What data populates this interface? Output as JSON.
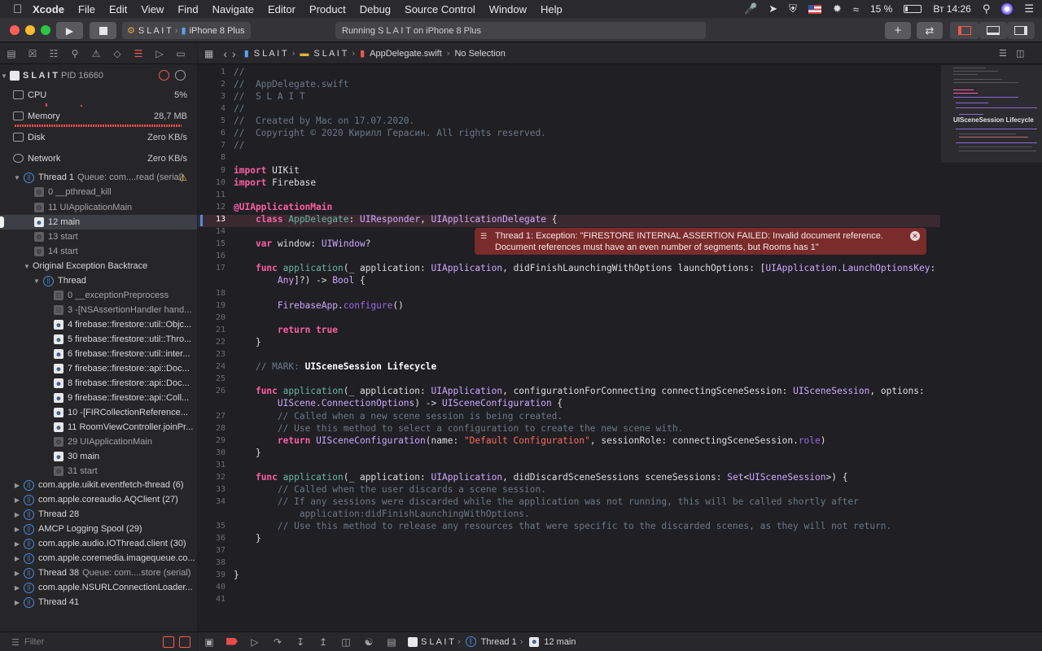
{
  "menubar": {
    "apple": "",
    "app": "Xcode",
    "items": [
      "File",
      "Edit",
      "View",
      "Find",
      "Navigate",
      "Editor",
      "Product",
      "Debug",
      "Source Control",
      "Window",
      "Help"
    ],
    "battery": "15 %",
    "clock": "Вт 14:26"
  },
  "toolbar": {
    "scheme_project": "S L A I T",
    "scheme_device": "iPhone 8 Plus",
    "activity": "Running S L A I T on iPhone 8 Plus"
  },
  "process": {
    "name": "S L A I T",
    "pid": "PID 16660"
  },
  "gauges": [
    {
      "label": "CPU",
      "value": "5%"
    },
    {
      "label": "Memory",
      "value": "28,7 MB"
    },
    {
      "label": "Disk",
      "value": "Zero KB/s"
    },
    {
      "label": "Network",
      "value": "Zero KB/s"
    }
  ],
  "thread1": {
    "name": "Thread 1",
    "queue": "Queue: com....read (serial)"
  },
  "frames1": [
    "0 __pthread_kill",
    "11 UIApplicationMain",
    "12 main",
    "13 start",
    "14 start"
  ],
  "backtrace": {
    "title": "Original Exception Backtrace",
    "thread": "Thread"
  },
  "frames2": [
    "0 __exceptionPreprocess",
    "3 -[NSAssertionHandler hand...",
    "4 firebase::firestore::util::Objc...",
    "5 firebase::firestore::util::Thro...",
    "6 firebase::firestore::util::inter...",
    "7 firebase::firestore::api::Doc...",
    "8 firebase::firestore::api::Doc...",
    "9 firebase::firestore::api::Coll...",
    "10 -[FIRCollectionReference...",
    "11 RoomViewController.joinPr...",
    "29 UIApplicationMain",
    "30 main",
    "31 start"
  ],
  "threads": [
    {
      "name": "com.apple.uikit.eventfetch-thread (6)",
      "queue": ""
    },
    {
      "name": "com.apple.coreaudio.AQClient (27)",
      "queue": ""
    },
    {
      "name": "Thread 28",
      "queue": ""
    },
    {
      "name": "AMCP Logging Spool (29)",
      "queue": ""
    },
    {
      "name": "com.apple.audio.IOThread.client (30)",
      "queue": ""
    },
    {
      "name": "com.apple.coremedia.imagequeue.co...",
      "queue": ""
    },
    {
      "name": "Thread 38",
      "queue": "Queue: com....store (serial)"
    },
    {
      "name": "com.apple.NSURLConnectionLoader...",
      "queue": ""
    },
    {
      "name": "Thread 41",
      "queue": ""
    }
  ],
  "filter": {
    "placeholder": "Filter"
  },
  "jumpbar": {
    "project": "S L A I T",
    "group": "S L A I T",
    "file": "AppDelegate.swift",
    "selection": "No Selection"
  },
  "error": {
    "line1": "Thread 1: Exception: \"FIRESTORE INTERNAL ASSERTION FAILED: Invalid document reference.",
    "line2": "Document references must have an even number of segments, but Rooms has 1\""
  },
  "minimap_label": "UISceneSession Lifecycle",
  "debugbar": {
    "project": "S L A I T",
    "thread": "Thread 1",
    "frame": "12 main"
  },
  "code": {
    "numbers": [
      "1",
      "2",
      "3",
      "4",
      "5",
      "6",
      "7",
      "8",
      "9",
      "10",
      "11",
      "12",
      "13",
      "14",
      "15",
      "16",
      "17",
      "",
      "18",
      "19",
      "20",
      "21",
      "22",
      "23",
      "24",
      "25",
      "26",
      "",
      "27",
      "28",
      "29",
      "30",
      "31",
      "32",
      "33",
      "34",
      "",
      "35",
      "36",
      "37",
      "38",
      "39",
      "40",
      "41"
    ],
    "c1": "//",
    "c2": "//  AppDelegate.swift",
    "c3": "//  S L A I T",
    "c4": "//",
    "c5": "//  Created by Mac on 17.07.2020.",
    "c6": "//  Copyright © 2020 Кирилл Герасин. All rights reserved.",
    "c7": "//",
    "import": "import",
    "uikit": "UIKit",
    "firebase": "Firebase",
    "attr": "@UIApplicationMain",
    "cls": "class",
    "appdel": "AppDelegate",
    "uiresp": "UIResponder",
    "uiappdel": "UIApplicationDelegate",
    "var": "var",
    "window": "window",
    "uiwindow": "UIWindow",
    "func": "func",
    "application": "application",
    "uiapp": "UIApplication",
    "launchkey": "UIApplication.LaunchOptionsKey",
    "any": "Any",
    "bool": "Bool",
    "fbapp": "FirebaseApp",
    "configure": "configure",
    "ret": "return",
    "true": "true",
    "mark": "// MARK: ",
    "markt": "UISceneSession Lifecycle",
    "uiss": "UISceneSession",
    "uiscene_conn": "UIScene.ConnectionOptions",
    "uisc": "UISceneConfiguration",
    "c27": "// Called when a new scene session is being created.",
    "c28": "// Use this method to select a configuration to create the new scene with.",
    "defcfg": "\"Default Configuration\"",
    "role": "role",
    "set": "Set",
    "c33": "// Called when the user discards a scene session.",
    "c34a": "// If any sessions were discarded while the application was not running, this will be called shortly after",
    "c34b": "application:didFinishLaunchingWithOptions.",
    "c35": "// Use this method to release any resources that were specific to the discarded scenes, as they will not return."
  }
}
